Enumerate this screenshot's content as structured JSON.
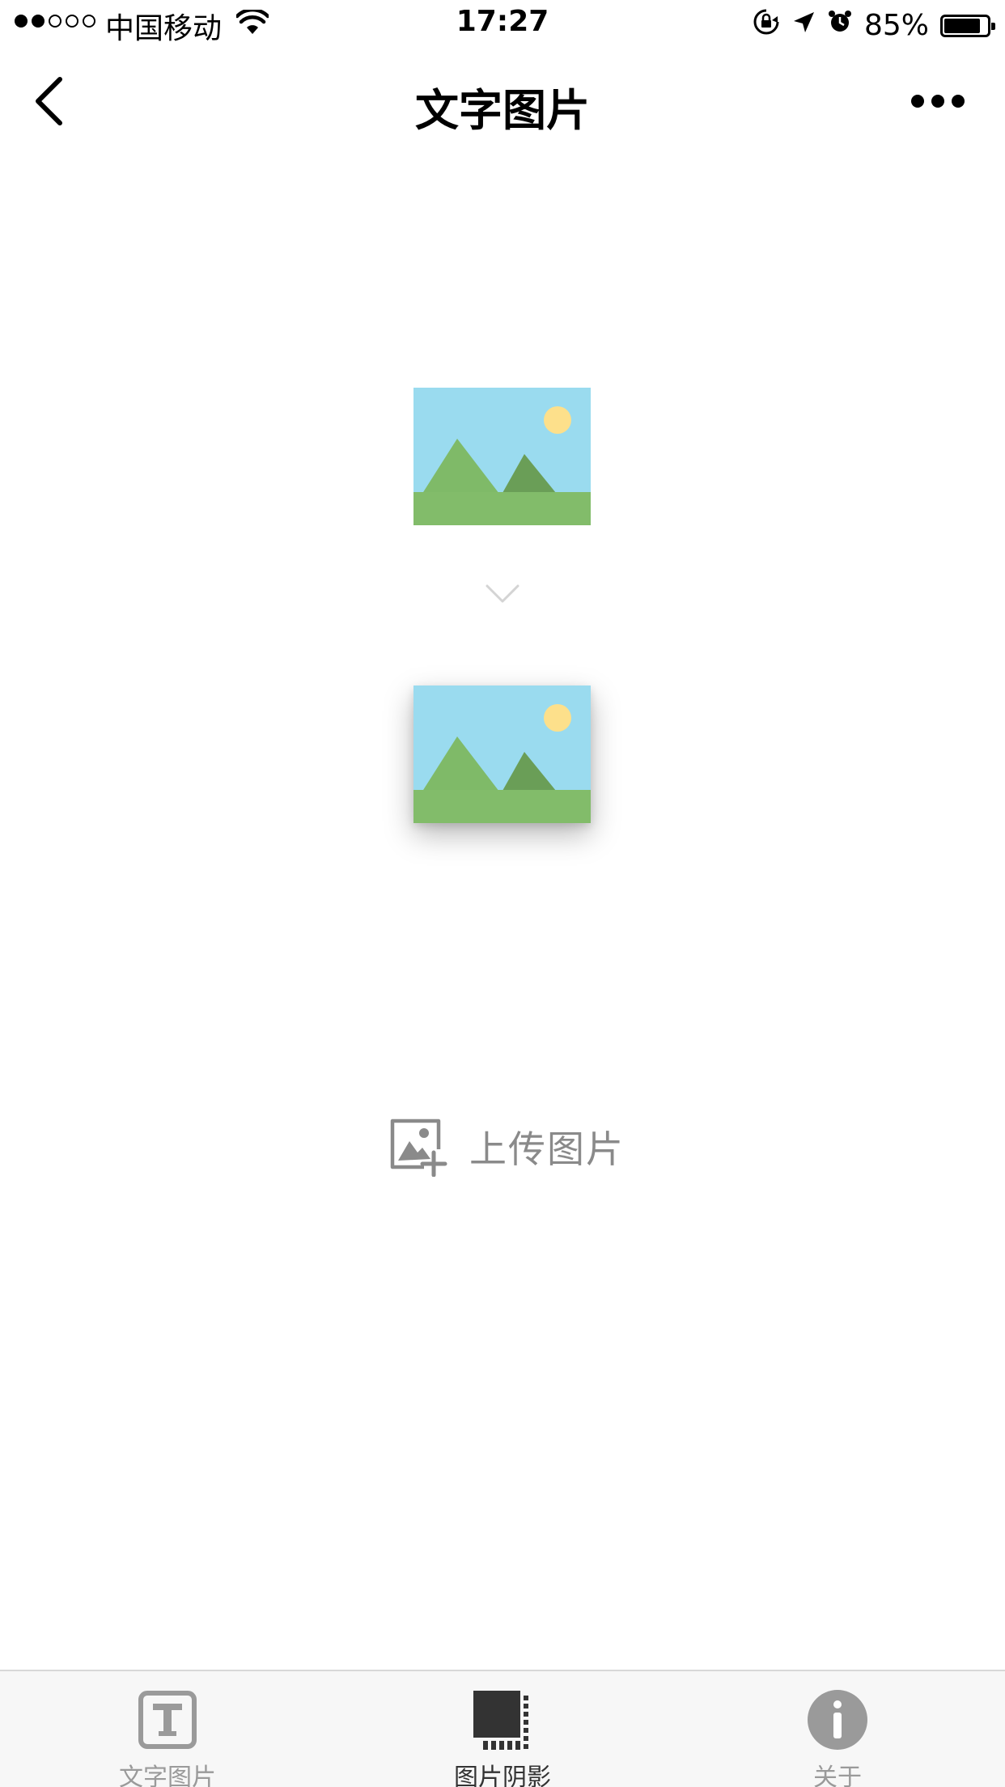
{
  "status_bar": {
    "signal_strength": "2 of 5",
    "carrier": "中国移动",
    "time": "17:27",
    "battery_percent": "85%",
    "battery_level": 0.85,
    "icons": [
      "wifi-icon",
      "rotation-lock-icon",
      "location-arrow-icon",
      "alarm-icon",
      "battery-icon"
    ]
  },
  "nav": {
    "title": "文字图片",
    "back_icon": "chevron-left-icon",
    "more_icon": "more-dots-icon"
  },
  "content": {
    "original_image_icon": "image-placeholder-icon",
    "arrow_icon": "chevron-down-icon",
    "shadowed_image_icon": "image-placeholder-icon",
    "upload_label": "上传图片",
    "upload_icon": "add-image-icon"
  },
  "tab_bar": {
    "tabs": [
      {
        "label": "文字图片",
        "icon": "text-t-icon",
        "active": false
      },
      {
        "label": "图片阴影",
        "icon": "image-shadow-icon",
        "active": true
      },
      {
        "label": "关于",
        "icon": "info-icon",
        "active": false
      }
    ]
  },
  "colors": {
    "sky": "#9ADBEF",
    "sun": "#FDE08B",
    "mountain": "#7FBA68",
    "mountain_dark": "#6A9E57",
    "ground": "#82BC6A",
    "tab_bar_bg": "#F7F7F7",
    "inactive_gray": "#9A9A9A",
    "active_dark": "#333333"
  }
}
